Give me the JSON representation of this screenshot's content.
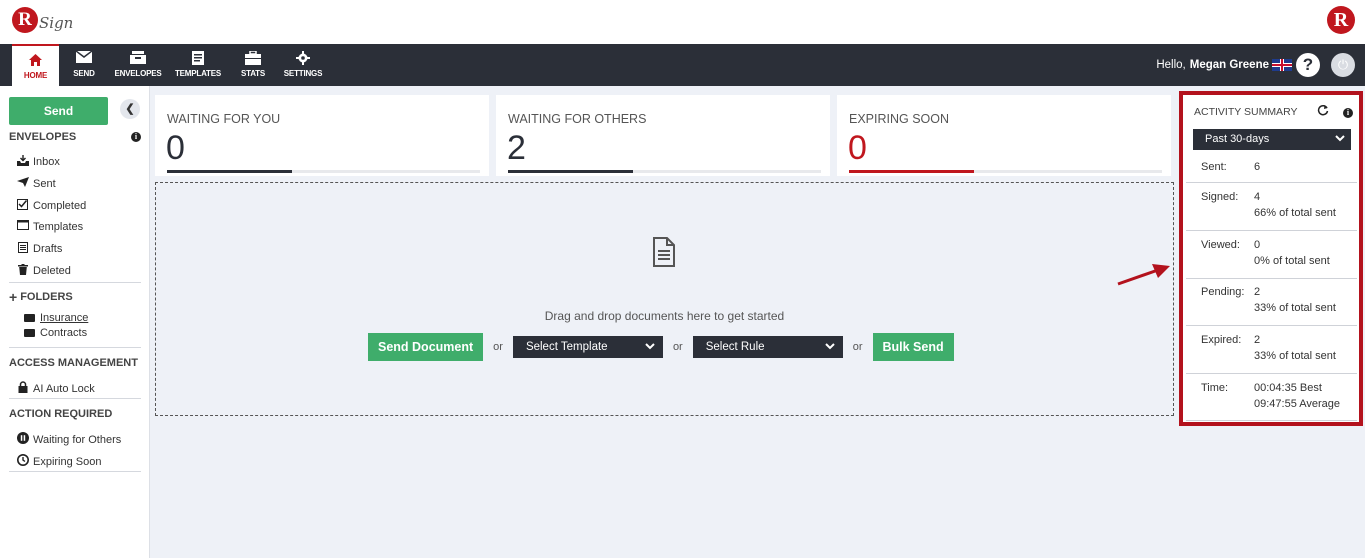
{
  "brand": {
    "logo_letter": "R",
    "logo_word": "Sign",
    "corner_logo_letter": "R"
  },
  "nav": {
    "items": [
      {
        "label": "HOME",
        "icon": "home-icon"
      },
      {
        "label": "SEND",
        "icon": "envelope-icon"
      },
      {
        "label": "ENVELOPES",
        "icon": "inbox-tray-icon"
      },
      {
        "label": "TEMPLATES",
        "icon": "document-icon"
      },
      {
        "label": "STATS",
        "icon": "briefcase-icon"
      },
      {
        "label": "SETTINGS",
        "icon": "gear-icon"
      }
    ],
    "greeting": "Hello,",
    "user_name": "Megan Greene",
    "help_glyph": "?",
    "power_glyph": "⏻"
  },
  "sidebar": {
    "send_label": "Send",
    "envelopes_heading": "ENVELOPES",
    "envelopes": [
      {
        "label": "Inbox",
        "icon": "inbox-icon"
      },
      {
        "label": "Sent",
        "icon": "paper-plane-icon"
      },
      {
        "label": "Completed",
        "icon": "checkbox-icon"
      },
      {
        "label": "Templates",
        "icon": "window-icon"
      },
      {
        "label": "Drafts",
        "icon": "draft-list-icon"
      },
      {
        "label": "Deleted",
        "icon": "trash-icon"
      }
    ],
    "folders_heading": "FOLDERS",
    "folders": [
      {
        "label": "Insurance"
      },
      {
        "label": "Contracts"
      }
    ],
    "access_heading": "ACCESS MANAGEMENT",
    "access_items": [
      {
        "label": "AI Auto Lock",
        "icon": "lock-icon"
      }
    ],
    "action_heading": "ACTION REQUIRED",
    "action_items": [
      {
        "label": "Waiting for Others",
        "icon": "pause-icon"
      },
      {
        "label": "Expiring Soon",
        "icon": "clock-icon"
      }
    ]
  },
  "cards": [
    {
      "label": "WAITING FOR YOU",
      "value": "0"
    },
    {
      "label": "WAITING FOR OTHERS",
      "value": "2"
    },
    {
      "label": "EXPIRING SOON",
      "value": "0"
    }
  ],
  "dropzone": {
    "text": "Drag and drop documents here to get started",
    "send_document": "Send Document",
    "or": "or",
    "select_template": "Select Template",
    "select_rule": "Select Rule",
    "bulk_send": "Bulk Send"
  },
  "activity": {
    "title": "ACTIVITY SUMMARY",
    "range": "Past 30-days",
    "rows": [
      {
        "label": "Sent:",
        "line1": "6",
        "line2": ""
      },
      {
        "label": "Signed:",
        "line1": "4",
        "line2": "66% of total sent"
      },
      {
        "label": "Viewed:",
        "line1": "0",
        "line2": "0% of total sent"
      },
      {
        "label": "Pending:",
        "line1": "2",
        "line2": "33% of total sent"
      },
      {
        "label": "Expired:",
        "line1": "2",
        "line2": "33% of total sent"
      },
      {
        "label": "Time:",
        "line1": "00:04:35 Best",
        "line2": "09:47:55 Average"
      }
    ]
  },
  "colors": {
    "brand_red": "#c0171e",
    "nav_dark": "#2b2f38",
    "action_green": "#3fad6b",
    "highlight_red": "#b3121d"
  }
}
